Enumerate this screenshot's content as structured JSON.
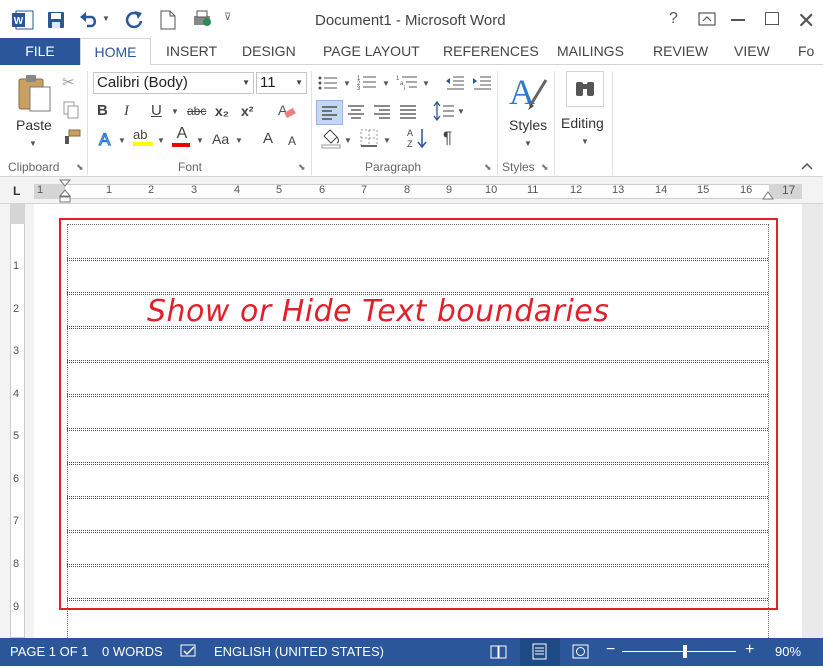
{
  "window": {
    "title": "Document1 - Microsoft Word",
    "help": "?"
  },
  "tabs": [
    "FILE",
    "HOME",
    "INSERT",
    "DESIGN",
    "PAGE LAYOUT",
    "REFERENCES",
    "MAILINGS",
    "REVIEW",
    "VIEW",
    "Fo"
  ],
  "ribbon": {
    "clipboard": {
      "label": "Clipboard",
      "paste": "Paste"
    },
    "font": {
      "label": "Font",
      "font_name": "Calibri (Body)",
      "font_size": "11",
      "bold": "B",
      "italic": "I",
      "underline": "U",
      "strike": "abc",
      "subscript": "x₂",
      "superscript": "x²",
      "grow": "A",
      "shrink": "A",
      "case": "Aa",
      "highlight": "ab",
      "fontcolor": "A"
    },
    "paragraph": {
      "label": "Paragraph",
      "pilcrow": "¶"
    },
    "styles": {
      "label": "Styles",
      "button": "Styles"
    },
    "editing": {
      "button": "Editing"
    }
  },
  "ruler": {
    "marker": "L",
    "ticks": [
      "1",
      "1",
      "2",
      "3",
      "4",
      "5",
      "6",
      "7",
      "8",
      "9",
      "10",
      "11",
      "12",
      "13",
      "14",
      "15",
      "16",
      "17"
    ],
    "vticks": [
      "1",
      "2",
      "3",
      "4",
      "5",
      "6",
      "7",
      "8",
      "9"
    ]
  },
  "document": {
    "overlay_text": "Show or Hide Text boundaries"
  },
  "status": {
    "page": "PAGE 1 OF 1",
    "words": "0 WORDS",
    "language": "ENGLISH (UNITED STATES)",
    "zoom": "90%",
    "zoom_fraction": 0.55
  },
  "colors": {
    "word_blue": "#2b579a",
    "annotation_red": "#e0202a"
  }
}
